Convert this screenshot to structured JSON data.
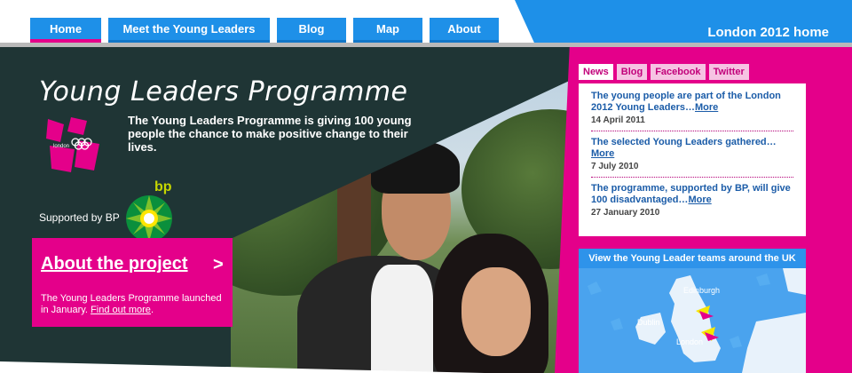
{
  "nav": {
    "tabs": [
      {
        "label": "Home",
        "active": true
      },
      {
        "label": "Meet the Young Leaders"
      },
      {
        "label": "Blog"
      },
      {
        "label": "Map"
      },
      {
        "label": "About"
      }
    ],
    "home_link": "London 2012 home"
  },
  "hero": {
    "title": "Young Leaders Programme",
    "intro": "The Young Leaders Programme is giving 100 young people the chance to make positive change to their lives.",
    "supported_by": "Supported by BP",
    "bp_wordmark": "bp",
    "logo_text": "london"
  },
  "about": {
    "title": "About the project",
    "arrow": ">",
    "text": "The Young Leaders Programme launched in January.",
    "link": "Find out more",
    "link_suffix": "."
  },
  "news": {
    "tabs": [
      {
        "label": "News",
        "active": true
      },
      {
        "label": "Blog"
      },
      {
        "label": "Facebook"
      },
      {
        "label": "Twitter"
      }
    ],
    "items": [
      {
        "text": "The young people are part of the London 2012 Young Leaders…",
        "more": "More",
        "date": "14 April 2011"
      },
      {
        "text": "The selected Young Leaders gathered…",
        "more": "More",
        "date": "7 July 2010"
      },
      {
        "text": "The programme, supported by BP, will give 100 disadvantaged…",
        "more": "More",
        "date": "27 January 2010"
      }
    ]
  },
  "map": {
    "title": "View the Young Leader teams around the UK",
    "labels": [
      "Edinburgh",
      "Dublin",
      "London"
    ]
  },
  "colors": {
    "magenta": "#e4008a",
    "blue": "#1e90e8",
    "dark_teal": "#1f3535",
    "link_blue": "#1b5ca8"
  },
  "icons": [
    "london-2012-logo-icon",
    "bp-helios-icon"
  ]
}
